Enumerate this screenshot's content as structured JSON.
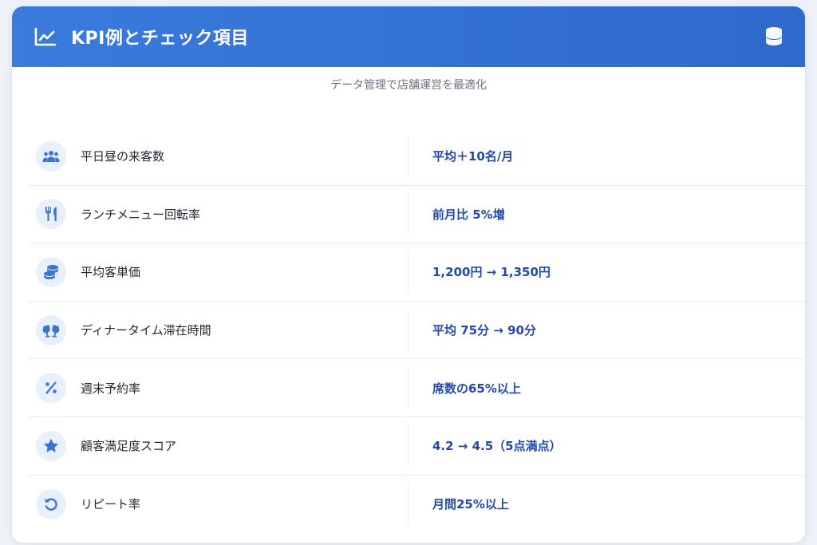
{
  "header": {
    "title": "KPI例とチェック項目",
    "title_icon": "line-chart-icon",
    "action_icon": "database-icon"
  },
  "subtitle": "データ管理で店舗運営を最適化",
  "colors": {
    "header_bg": "#3a7bde",
    "value_text": "#244aa5",
    "icon_color": "#3b74d6",
    "icon_bg": "#e8f0fc"
  },
  "kpis": [
    {
      "icon": "users-icon",
      "label": "平日昼の来客数",
      "value": "平均＋10名/月"
    },
    {
      "icon": "utensils-icon",
      "label": "ランチメニュー回転率",
      "value": "前月比 5%増"
    },
    {
      "icon": "coins-icon",
      "label": "平均客単価",
      "value": "1,200円 → 1,350円"
    },
    {
      "icon": "glasses-cheers-icon",
      "label": "ディナータイム滞在時間",
      "value": "平均 75分 → 90分"
    },
    {
      "icon": "percent-icon",
      "label": "週末予約率",
      "value": "席数の65%以上"
    },
    {
      "icon": "star-icon",
      "label": "顧客満足度スコア",
      "value": "4.2 → 4.5（5点満点）"
    },
    {
      "icon": "undo-icon",
      "label": "リピート率",
      "value": "月間25%以上"
    }
  ]
}
